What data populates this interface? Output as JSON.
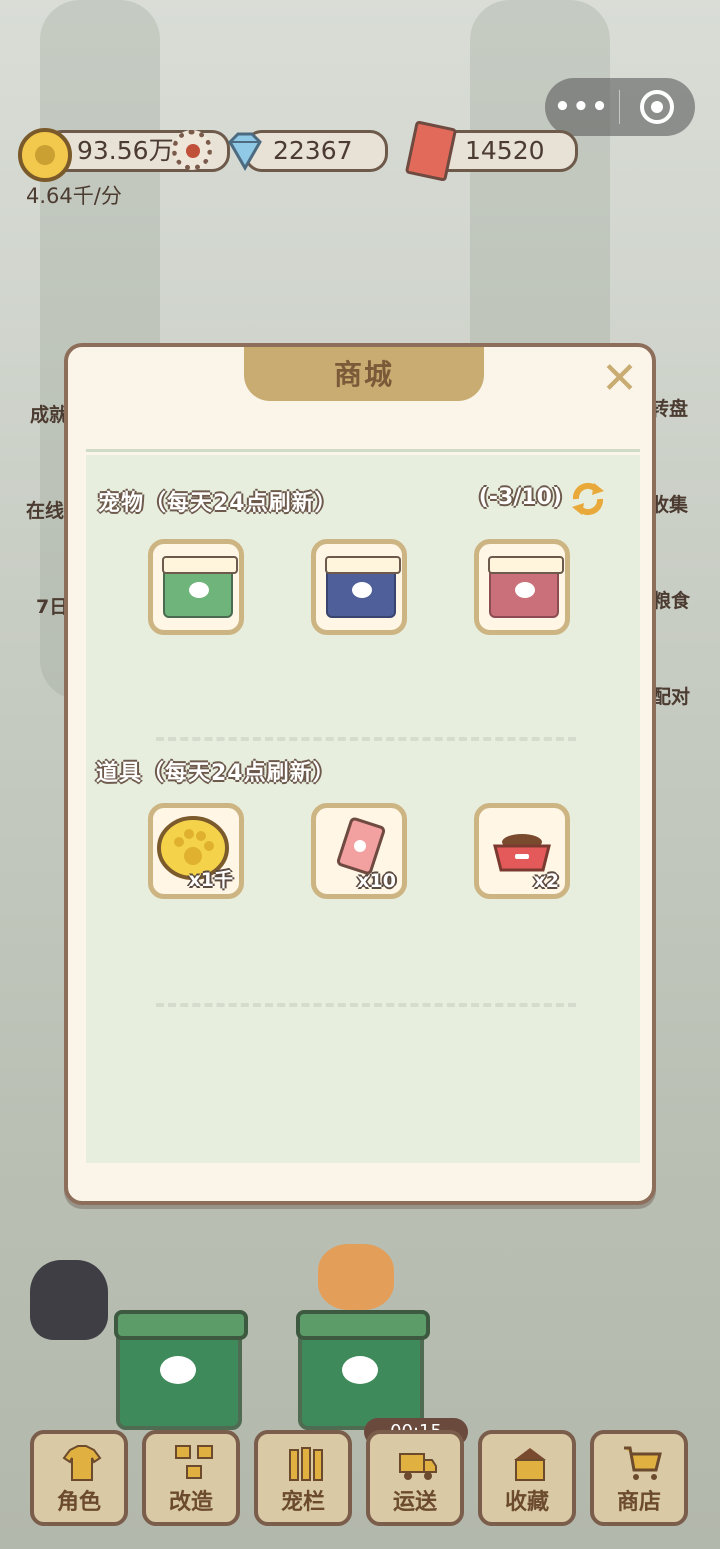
{
  "topbar": {
    "coins": "93.56万",
    "diamonds": "22367",
    "tickets": "14520",
    "rate": "4.64千/分"
  },
  "side_left": [
    "成就",
    "在线",
    "7日"
  ],
  "side_right": [
    "转盘",
    "收集",
    "粮食",
    "配对"
  ],
  "shop": {
    "title": "商城",
    "close_icon": "close-icon",
    "pets_title": "宠物（每天24点刷新）",
    "refresh_counter": "(-3/10)",
    "pets": [
      {
        "name": "green-box",
        "color": "#6fb47a"
      },
      {
        "name": "blue-box",
        "color": "#4f5f9a"
      },
      {
        "name": "red-box",
        "color": "#c9707a"
      }
    ],
    "items_title": "道具（每天24点刷新）",
    "items": [
      {
        "icon": "coin-icon",
        "qty": "x1千"
      },
      {
        "icon": "ticket-icon",
        "qty": "x10"
      },
      {
        "icon": "food-bowl-icon",
        "qty": "x2"
      }
    ]
  },
  "nav": {
    "timer": "00:15",
    "items": [
      {
        "label": "角色",
        "icon": "shirt-icon"
      },
      {
        "label": "改造",
        "icon": "tools-icon"
      },
      {
        "label": "宠栏",
        "icon": "fence-icon"
      },
      {
        "label": "运送",
        "icon": "truck-icon"
      },
      {
        "label": "收藏",
        "icon": "house-icon"
      },
      {
        "label": "商店",
        "icon": "cart-icon"
      }
    ]
  }
}
